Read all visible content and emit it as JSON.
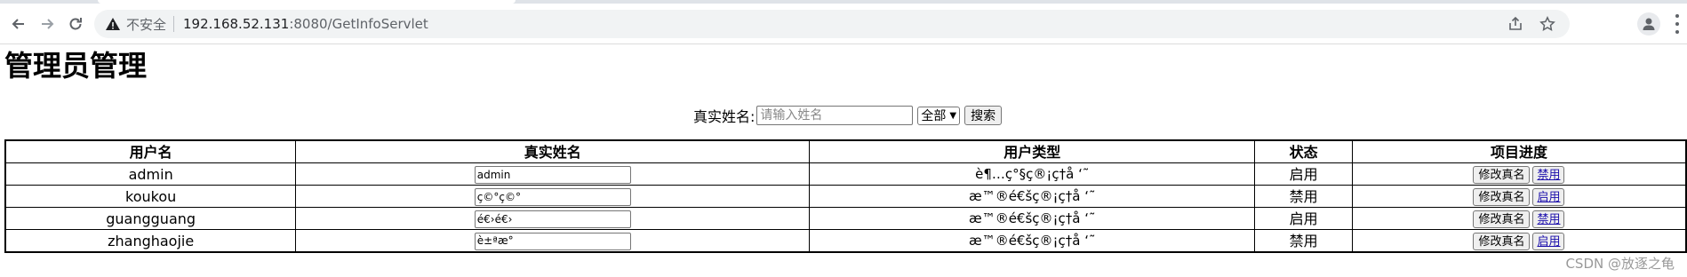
{
  "browser": {
    "security_label": "不安全",
    "url_host": "192.168.52.131",
    "url_path": ":8080/GetInfoServlet"
  },
  "page": {
    "title": "管理员管理"
  },
  "search": {
    "label": "真实姓名:",
    "placeholder": "请输入姓名",
    "select_value": "全部",
    "button_label": "搜索"
  },
  "table": {
    "headers": [
      "用户名",
      "真实姓名",
      "用户类型",
      "状态",
      "项目进度"
    ],
    "rows": [
      {
        "username": "admin",
        "realname": "admin",
        "type": "è¶…ç°§ç®¡ç†å ‘˜",
        "status": "启用",
        "edit": "修改真名",
        "toggle": "禁用"
      },
      {
        "username": "koukou",
        "realname": "ç©°ç©°",
        "type": "æ™®é€šç®¡ç†å ‘˜",
        "status": "禁用",
        "edit": "修改真名",
        "toggle": "启用"
      },
      {
        "username": "guangguang",
        "realname": "é€›é€›",
        "type": "æ™®é€šç®¡ç†å ‘˜",
        "status": "启用",
        "edit": "修改真名",
        "toggle": "禁用"
      },
      {
        "username": "zhanghaojie",
        "realname": "è±ªæ°",
        "type": "æ™®é€šç®¡ç†å ‘˜",
        "status": "禁用",
        "edit": "修改真名",
        "toggle": "启用"
      }
    ]
  },
  "watermark": "CSDN @放逐之龟"
}
